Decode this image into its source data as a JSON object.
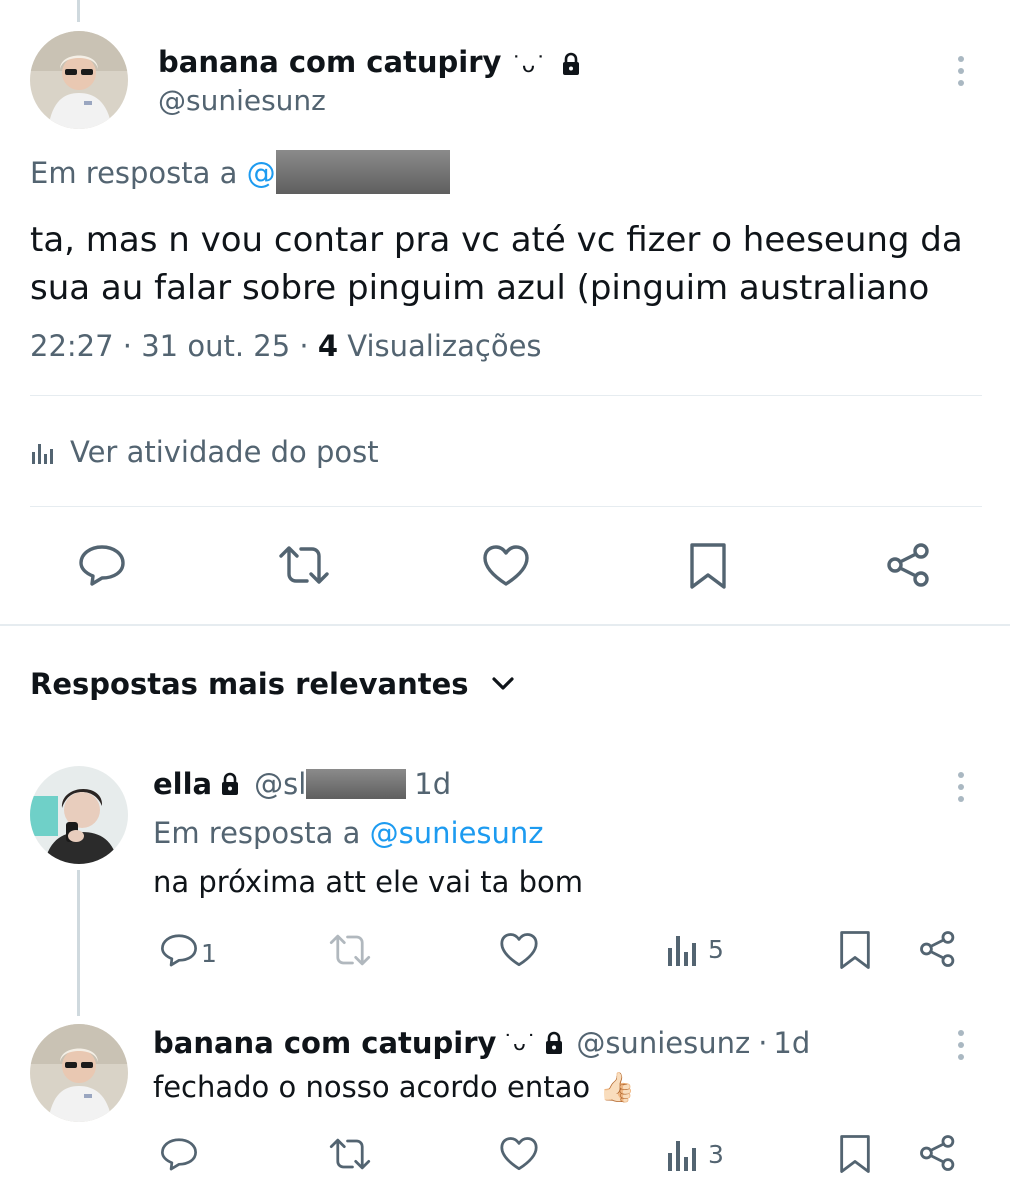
{
  "main_post": {
    "display_name": "banana com catupiry",
    "emoji_suffix": "˙ᴗ˙",
    "handle": "@suniesunz",
    "reply_to_prefix": "Em resposta a",
    "reply_to_at": "@",
    "text_line1": "ta, mas n vou contar pra vc até vc fizer o heeseung da",
    "text_line2": "sua au falar sobre pinguim azul (pinguim australiano",
    "time": "22:27",
    "sep1": "·",
    "date": "31 out. 25",
    "sep2": "·",
    "views_count": "4",
    "views_label": "Visualizações",
    "activity_label": "Ver atividade do post"
  },
  "replies_header": {
    "label": "Respostas mais relevantes"
  },
  "reply1": {
    "display_name": "ella",
    "handle_prefix": "@sl",
    "time": "1d",
    "reply_to_prefix": "Em resposta a",
    "reply_to_handle": "@suniesunz",
    "text": "na próxima att ele vai ta bom",
    "reply_count": "1",
    "views_count": "5"
  },
  "reply2": {
    "display_name": "banana com catupiry",
    "emoji_suffix": "˙ᴗ˙",
    "handle": "@suniesunz",
    "sep": "·",
    "time": "1d",
    "text": "fechado o nosso acordo entao",
    "emoji": "👍🏻",
    "views_count": "3"
  },
  "colors": {
    "text": "#0f1419",
    "muted": "#536471",
    "link": "#1d9bf0",
    "divider": "#e6ecf0"
  }
}
